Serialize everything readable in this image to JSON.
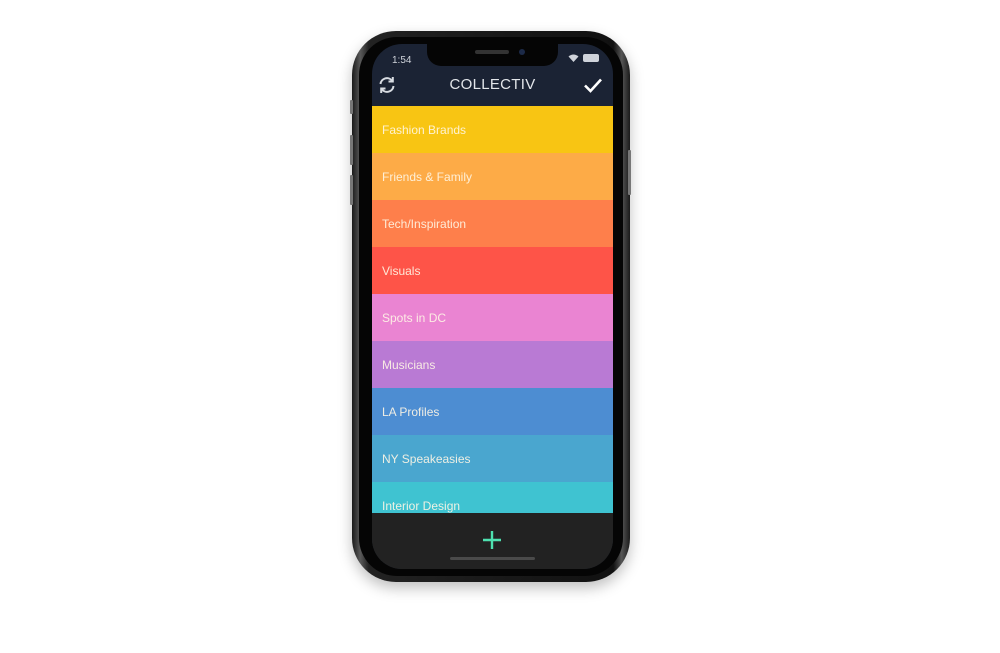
{
  "status_bar": {
    "time": "1:54"
  },
  "header": {
    "title": "COLLECTIV",
    "left_icon": "refresh-icon",
    "right_icon": "checkmark-icon"
  },
  "collections": [
    {
      "label": "Fashion Brands",
      "color": "#f8c513"
    },
    {
      "label": "Friends & Family",
      "color": "#fdab47"
    },
    {
      "label": "Tech/Inspiration",
      "color": "#fe7f4b"
    },
    {
      "label": "Visuals",
      "color": "#fe5448"
    },
    {
      "label": "Spots in DC",
      "color": "#ea84d2"
    },
    {
      "label": "Musicians",
      "color": "#b97ad4"
    },
    {
      "label": "LA Profiles",
      "color": "#4d8dd2"
    },
    {
      "label": "NY Speakeasies",
      "color": "#4aa6cf"
    },
    {
      "label": "Interior Design",
      "color": "#3fc3d1"
    }
  ],
  "bottom_bar": {
    "add_icon": "plus-icon",
    "accent": "#4ee0b0"
  }
}
